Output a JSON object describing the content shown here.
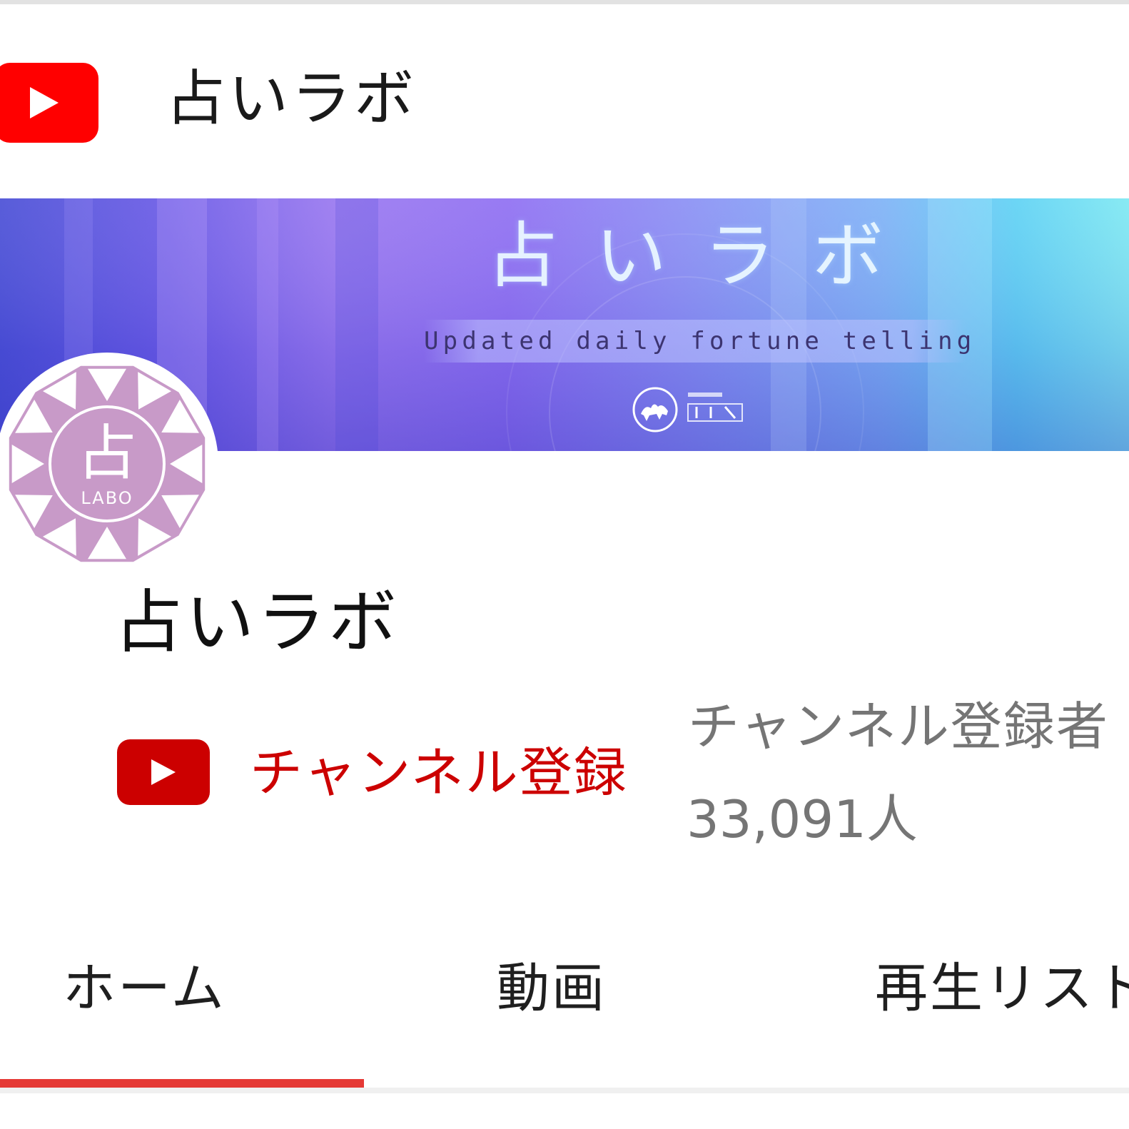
{
  "header": {
    "title": "占いラボ",
    "logo_icon": "youtube-logo-icon"
  },
  "banner": {
    "title": "占いラボ",
    "tagline": "Updated daily fortune telling"
  },
  "channel": {
    "name": "占いラボ",
    "avatar_text": "占",
    "avatar_subtext": "LABO"
  },
  "subscribe": {
    "label": "チャンネル登録",
    "icon": "youtube-play-icon"
  },
  "subscribers": {
    "label": "チャンネル登録者",
    "count": "33,091人"
  },
  "tabs": [
    {
      "label": "ホーム",
      "active": true
    },
    {
      "label": "動画",
      "active": false
    },
    {
      "label": "再生リスト",
      "active": false
    }
  ],
  "colors": {
    "youtube_red": "#ff0000",
    "subscribe_red": "#cc0000",
    "tab_indicator": "#e53935",
    "avatar_purple": "#c89ac8"
  }
}
